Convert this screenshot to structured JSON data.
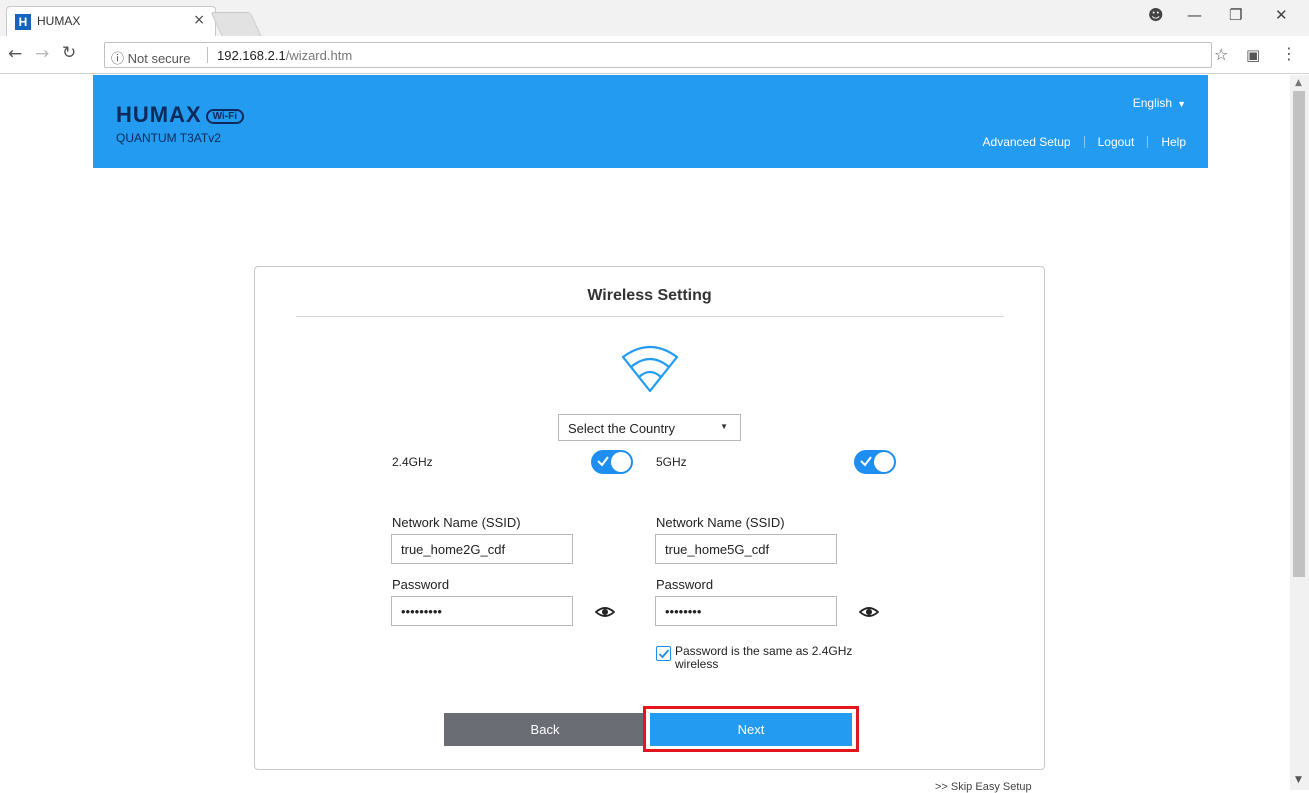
{
  "browser": {
    "tab_title": "HUMAX",
    "tab_favicon": "H",
    "tab_close": "×",
    "security_label": "ⓘ Not secure",
    "url_host": "192.168.2.1",
    "url_path": "/wizard.htm",
    "icons": [
      "back-arrow-icon",
      "forward-arrow-icon",
      "reload-icon",
      "bookmark-star-icon",
      "cast-icon",
      "menu-icon",
      "account-icon",
      "minimize-icon",
      "restore-icon",
      "close-icon"
    ]
  },
  "header": {
    "brand": "HUMAX",
    "brand_badge": "Wi-Fi",
    "model": "QUANTUM T3ATv2",
    "language": "English",
    "links": [
      "Advanced Setup",
      "Logout",
      "Help"
    ],
    "background": "#229bf0"
  },
  "wizard": {
    "title": "Wireless Setting",
    "country_select": "Select the Country",
    "band_24": {
      "label": "2.4GHz",
      "enabled": true,
      "ssid_label": "Network Name (SSID)",
      "ssid_value": "true_home2G_cdf",
      "password_label": "Password",
      "password_value": "•••••••••"
    },
    "band_5": {
      "label": "5GHz",
      "enabled": true,
      "ssid_label": "Network Name (SSID)",
      "ssid_value": "true_home5G_cdf",
      "password_label": "Password",
      "password_value": "••••••••"
    },
    "same_password_label": "Password is the same as 2.4GHz wireless",
    "same_password_checked": true,
    "back_label": "Back",
    "next_label": "Next",
    "skip_label": ">> Skip Easy Setup",
    "accent": "#1e8ff0",
    "highlight": "#e0161c"
  }
}
